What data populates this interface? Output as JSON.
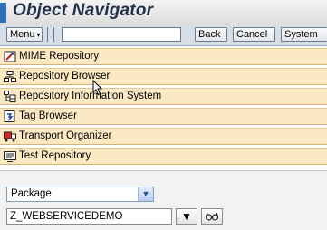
{
  "app": {
    "title": "Object Navigator"
  },
  "toolbar": {
    "menu_label": "Menu",
    "command_field_value": "",
    "back_label": "Back",
    "cancel_label": "Cancel",
    "system_label": "System"
  },
  "nav": {
    "items": [
      {
        "label": "MIME Repository",
        "icon": "mime-repository-icon"
      },
      {
        "label": "Repository Browser",
        "icon": "repository-browser-icon"
      },
      {
        "label": "Repository Information System",
        "icon": "repository-information-system-icon"
      },
      {
        "label": "Tag Browser",
        "icon": "tag-browser-icon"
      },
      {
        "label": "Transport Organizer",
        "icon": "transport-organizer-icon"
      },
      {
        "label": "Test Repository",
        "icon": "test-repository-icon"
      }
    ]
  },
  "browser": {
    "object_type_selected": "Package",
    "object_name_value": "Z_WEBSERVICEDEMO"
  },
  "colors": {
    "title_accent": "#2f6fb7",
    "nav_row_bg": "#fbe9c4",
    "toolbar_bg": "#d8dee8"
  }
}
